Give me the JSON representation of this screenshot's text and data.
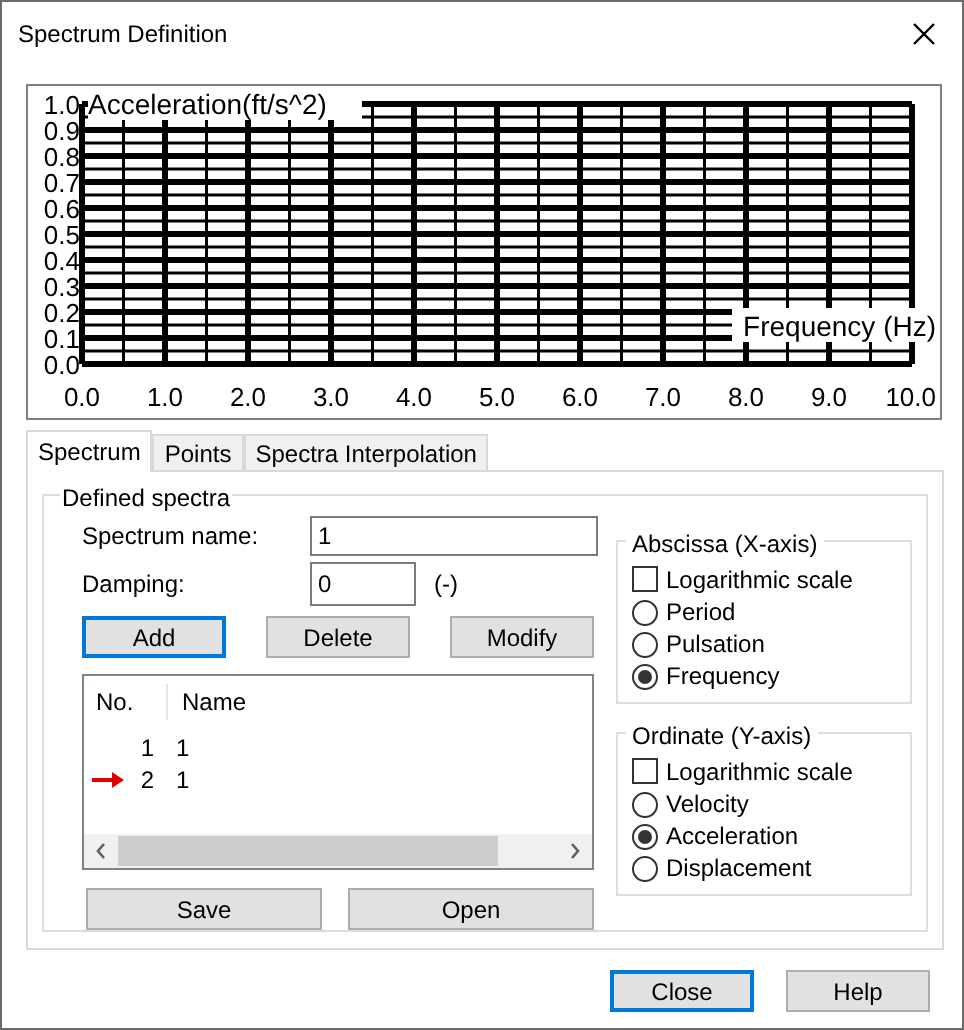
{
  "window": {
    "title": "Spectrum Definition"
  },
  "chart": {
    "chart_data": {
      "type": "line",
      "grid": true,
      "xlabel": "Frequency (Hz)",
      "ylabel": "Acceleration(ft/s^2)",
      "xlim": [
        0,
        10
      ],
      "ylim": [
        0,
        1
      ],
      "xticks": [
        {
          "value": 0,
          "label": "0.0"
        },
        {
          "value": 1,
          "label": "1.0"
        },
        {
          "value": 2,
          "label": "2.0"
        },
        {
          "value": 3,
          "label": "3.0"
        },
        {
          "value": 4,
          "label": "4.0"
        },
        {
          "value": 5,
          "label": "5.0"
        },
        {
          "value": 6,
          "label": "6.0"
        },
        {
          "value": 7,
          "label": "7.0"
        },
        {
          "value": 8,
          "label": "8.0"
        },
        {
          "value": 9,
          "label": "9.0"
        },
        {
          "value": 10,
          "label": "10.0"
        }
      ],
      "yticks": [
        {
          "value": 0,
          "label": "0.0"
        },
        {
          "value": 0.1,
          "label": "0.1"
        },
        {
          "value": 0.2,
          "label": "0.2"
        },
        {
          "value": 0.3,
          "label": "0.3"
        },
        {
          "value": 0.4,
          "label": "0.4"
        },
        {
          "value": 0.5,
          "label": "0.5"
        },
        {
          "value": 0.6,
          "label": "0.6"
        },
        {
          "value": 0.7,
          "label": "0.7"
        },
        {
          "value": 0.8,
          "label": "0.8"
        },
        {
          "value": 0.9,
          "label": "0.9"
        },
        {
          "value": 1,
          "label": "1.0"
        }
      ]
    }
  },
  "tabs": [
    {
      "label": "Spectrum",
      "selected": true
    },
    {
      "label": "Points",
      "selected": false
    },
    {
      "label": "Spectra Interpolation",
      "selected": false
    }
  ],
  "defined_spectra": {
    "title": "Defined spectra",
    "spectrum_name": {
      "label": "Spectrum name:",
      "value": "1"
    },
    "damping": {
      "label": "Damping:",
      "value": "0",
      "unit": "(-)"
    },
    "buttons": [
      {
        "label": "Add",
        "focused": true
      },
      {
        "label": "Delete",
        "focused": false
      },
      {
        "label": "Modify",
        "focused": false
      }
    ],
    "list": {
      "columns": [
        "No.",
        "Name"
      ],
      "rows": [
        {
          "no": "1",
          "name": "1",
          "current": false
        },
        {
          "no": "2",
          "name": "1",
          "current": true
        }
      ]
    },
    "file_buttons": [
      "Save",
      "Open"
    ]
  },
  "abscissa": {
    "title": "Abscissa (X-axis)",
    "log_scale": {
      "label": "Logarithmic scale",
      "checked": false
    },
    "options": [
      {
        "label": "Period",
        "selected": false
      },
      {
        "label": "Pulsation",
        "selected": false
      },
      {
        "label": "Frequency",
        "selected": true
      }
    ]
  },
  "ordinate": {
    "title": "Ordinate (Y-axis)",
    "log_scale": {
      "label": "Logarithmic scale",
      "checked": false
    },
    "options": [
      {
        "label": "Velocity",
        "selected": false
      },
      {
        "label": "Acceleration",
        "selected": true
      },
      {
        "label": "Displacement",
        "selected": false
      }
    ]
  },
  "buttons": [
    {
      "label": "Close",
      "focused": true
    },
    {
      "label": "Help",
      "focused": false
    }
  ]
}
